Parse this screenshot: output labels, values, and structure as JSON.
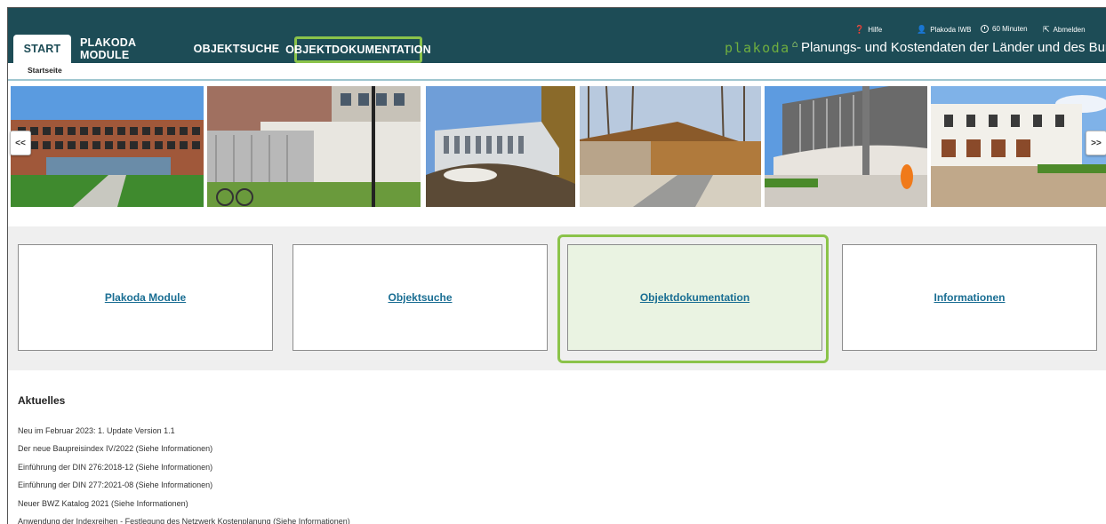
{
  "tabs": [
    {
      "label": "START"
    },
    {
      "label": "PLAKODA MODULE"
    },
    {
      "label": "OBJEKTSUCHE"
    },
    {
      "label": "OBJEKTDOKUMENTATION"
    }
  ],
  "breadcrumb": "Startseite",
  "logo": {
    "text": "plakoda",
    "mark": "⌂"
  },
  "header_title": "Planungs- und Kostendaten der Länder und des Bundes",
  "utility": {
    "help": "Hilfe",
    "user": "Plakoda IWB",
    "timer": "60 Minuten",
    "logout": "Abmelden"
  },
  "carousel": {
    "prev_label": "<<",
    "next_label": ">>",
    "photos": [
      "modern-office-building",
      "service-building-with-bicycles",
      "curved-white-building",
      "timber-sports-hall",
      "round-modern-building",
      "white-terraced-building"
    ]
  },
  "tiles": [
    {
      "label": "Plakoda Module"
    },
    {
      "label": "Objektsuche"
    },
    {
      "label": "Objektdokumentation"
    },
    {
      "label": "Informationen"
    }
  ],
  "news": {
    "title": "Aktuelles",
    "items": [
      "Neu im Februar 2023: 1. Update Version 1.1",
      "Der neue Baupreisindex IV/2022 (Siehe Informationen)",
      "Einführung der DIN 276:2018-12 (Siehe Informationen)",
      "Einführung der DIN 277:2021-08 (Siehe Informationen)",
      "Neuer BWZ Katalog 2021 (Siehe Informationen)",
      "Anwendung der Indexreihen - Festlegung des Netzwerk Kostenplanung (Siehe Informationen)"
    ]
  },
  "colors": {
    "header_bg": "#1d4c56",
    "highlight": "#8bc34a",
    "link": "#1a6e93",
    "logo": "#6fae3f"
  }
}
